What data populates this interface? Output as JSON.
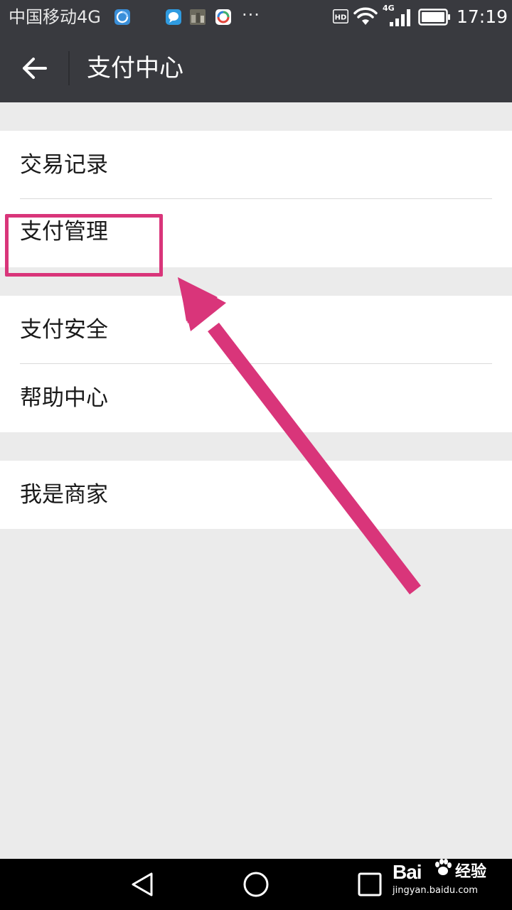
{
  "status_bar": {
    "carrier": "中国移动4G",
    "more": "···",
    "hd": "HD",
    "network": "4G",
    "time": "17:19",
    "icons": [
      "browser-icon",
      "chat-app-icon",
      "photo-thumbnail-icon",
      "camera-app-icon",
      "hd-icon",
      "wifi-icon",
      "signal-icon",
      "battery-icon"
    ]
  },
  "header": {
    "title": "支付中心",
    "back_icon": "arrow-left-icon"
  },
  "groups": [
    {
      "items": [
        {
          "label": "交易记录"
        },
        {
          "label": "支付管理"
        }
      ]
    },
    {
      "items": [
        {
          "label": "支付安全"
        },
        {
          "label": "帮助中心"
        }
      ]
    },
    {
      "items": [
        {
          "label": "我是商家"
        }
      ]
    }
  ],
  "annotation": {
    "color": "#d9357a",
    "target": "支付管理"
  },
  "nav_bar": {
    "icons": [
      "back-triangle-icon",
      "home-circle-icon",
      "recents-square-icon"
    ]
  },
  "watermark": {
    "brand": "Bai",
    "brand_suffix": "经验",
    "url": "jingyan.baidu.com"
  },
  "colors": {
    "header_bg": "#393a3f",
    "page_bg": "#ebebeb",
    "card_bg": "#ffffff",
    "text": "#1a1a1a",
    "accent": "#d9357a"
  }
}
